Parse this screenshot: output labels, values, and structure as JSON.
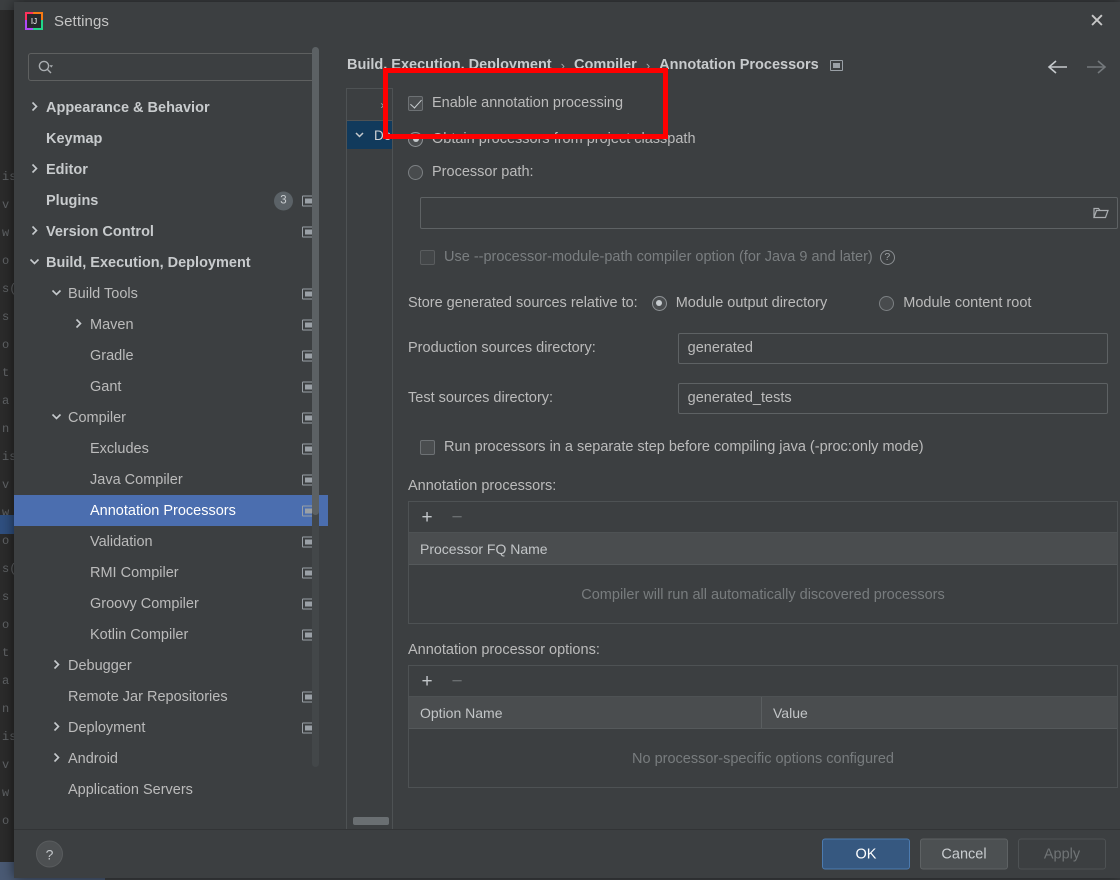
{
  "window": {
    "title": "Settings",
    "logo_icon": "intellij-idea-logo",
    "close_icon": "close-icon"
  },
  "sidebar": {
    "search": {
      "placeholder": "",
      "value": "",
      "icon": "search-icon"
    },
    "items": [
      {
        "label": "Appearance & Behavior",
        "indent": 0,
        "chevron": "right",
        "bold": true,
        "badge": null,
        "project_icon": false,
        "selected": false
      },
      {
        "label": "Keymap",
        "indent": 0,
        "chevron": "none",
        "bold": true,
        "badge": null,
        "project_icon": false,
        "selected": false
      },
      {
        "label": "Editor",
        "indent": 0,
        "chevron": "right",
        "bold": true,
        "badge": null,
        "project_icon": false,
        "selected": false
      },
      {
        "label": "Plugins",
        "indent": 0,
        "chevron": "none",
        "bold": true,
        "badge": "3",
        "project_icon": true,
        "selected": false
      },
      {
        "label": "Version Control",
        "indent": 0,
        "chevron": "right",
        "bold": true,
        "badge": null,
        "project_icon": true,
        "selected": false
      },
      {
        "label": "Build, Execution, Deployment",
        "indent": 0,
        "chevron": "down",
        "bold": true,
        "badge": null,
        "project_icon": false,
        "selected": false
      },
      {
        "label": "Build Tools",
        "indent": 1,
        "chevron": "down",
        "bold": false,
        "badge": null,
        "project_icon": true,
        "selected": false
      },
      {
        "label": "Maven",
        "indent": 2,
        "chevron": "right",
        "bold": false,
        "badge": null,
        "project_icon": true,
        "selected": false
      },
      {
        "label": "Gradle",
        "indent": 2,
        "chevron": "none",
        "bold": false,
        "badge": null,
        "project_icon": true,
        "selected": false
      },
      {
        "label": "Gant",
        "indent": 2,
        "chevron": "none",
        "bold": false,
        "badge": null,
        "project_icon": true,
        "selected": false
      },
      {
        "label": "Compiler",
        "indent": 1,
        "chevron": "down",
        "bold": false,
        "badge": null,
        "project_icon": true,
        "selected": false
      },
      {
        "label": "Excludes",
        "indent": 2,
        "chevron": "none",
        "bold": false,
        "badge": null,
        "project_icon": true,
        "selected": false
      },
      {
        "label": "Java Compiler",
        "indent": 2,
        "chevron": "none",
        "bold": false,
        "badge": null,
        "project_icon": true,
        "selected": false
      },
      {
        "label": "Annotation Processors",
        "indent": 2,
        "chevron": "none",
        "bold": false,
        "badge": null,
        "project_icon": true,
        "selected": true
      },
      {
        "label": "Validation",
        "indent": 2,
        "chevron": "none",
        "bold": false,
        "badge": null,
        "project_icon": true,
        "selected": false
      },
      {
        "label": "RMI Compiler",
        "indent": 2,
        "chevron": "none",
        "bold": false,
        "badge": null,
        "project_icon": true,
        "selected": false
      },
      {
        "label": "Groovy Compiler",
        "indent": 2,
        "chevron": "none",
        "bold": false,
        "badge": null,
        "project_icon": true,
        "selected": false
      },
      {
        "label": "Kotlin Compiler",
        "indent": 2,
        "chevron": "none",
        "bold": false,
        "badge": null,
        "project_icon": true,
        "selected": false
      },
      {
        "label": "Debugger",
        "indent": 1,
        "chevron": "right",
        "bold": false,
        "badge": null,
        "project_icon": false,
        "selected": false
      },
      {
        "label": "Remote Jar Repositories",
        "indent": 1,
        "chevron": "none",
        "bold": false,
        "badge": null,
        "project_icon": true,
        "selected": false
      },
      {
        "label": "Deployment",
        "indent": 1,
        "chevron": "right",
        "bold": false,
        "badge": null,
        "project_icon": true,
        "selected": false
      },
      {
        "label": "Android",
        "indent": 1,
        "chevron": "right",
        "bold": false,
        "badge": null,
        "project_icon": false,
        "selected": false
      },
      {
        "label": "Application Servers",
        "indent": 1,
        "chevron": "none",
        "bold": false,
        "badge": null,
        "project_icon": false,
        "selected": false
      }
    ]
  },
  "breadcrumb": {
    "items": [
      "Build, Execution, Deployment",
      "Compiler",
      "Annotation Processors"
    ],
    "separator": "›",
    "trailing_icon": "project-scope-icon",
    "back_icon": "arrow-left-icon",
    "forward_icon": "arrow-right-icon"
  },
  "module_strip": {
    "expand_label": "»",
    "rows": [
      {
        "label": "De",
        "chevron": "down",
        "selected": true
      }
    ]
  },
  "main": {
    "enable_annotation_processing": {
      "label": "Enable annotation processing",
      "checked": true
    },
    "source_mode": {
      "options": [
        {
          "label": "Obtain processors from project classpath",
          "selected": true
        },
        {
          "label": "Processor path:",
          "selected": false
        }
      ]
    },
    "processor_path": {
      "value": "",
      "placeholder": "",
      "browse_icon": "folder-icon"
    },
    "use_module_path": {
      "label": "Use --processor-module-path compiler option (for Java 9 and later)",
      "checked": false,
      "disabled": true,
      "help_icon": "help-circle-icon",
      "help_glyph": "?"
    },
    "store_relative": {
      "label": "Store generated sources relative to:",
      "options": [
        {
          "label": "Module output directory",
          "selected": true
        },
        {
          "label": "Module content root",
          "selected": false
        }
      ]
    },
    "production_sources": {
      "label": "Production sources directory:",
      "value": "generated"
    },
    "test_sources": {
      "label": "Test sources directory:",
      "value": "generated_tests"
    },
    "run_separate_step": {
      "label": "Run processors in a separate step before compiling java (-proc:only mode)",
      "checked": false
    },
    "processors_table": {
      "label": "Annotation processors:",
      "add_label": "+",
      "remove_label": "−",
      "columns": [
        "Processor FQ Name"
      ],
      "rows": [],
      "empty_text": "Compiler will run all automatically discovered processors"
    },
    "options_table": {
      "label": "Annotation processor options:",
      "add_label": "+",
      "remove_label": "−",
      "columns": [
        "Option Name",
        "Value"
      ],
      "rows": [],
      "empty_text": "No processor-specific options configured"
    }
  },
  "footer": {
    "help_glyph": "?",
    "ok_label": "OK",
    "cancel_label": "Cancel",
    "apply_label": "Apply",
    "apply_disabled": true
  },
  "annotation": {
    "shape": "rectangle",
    "color": "#ff0000",
    "target": "Enable annotation processing"
  },
  "colors": {
    "background": "#3c3f41",
    "editor_background": "#2b2b2b",
    "selection": "#4b6eaf",
    "primary_button": "#365880",
    "annotation": "#ff0000"
  }
}
